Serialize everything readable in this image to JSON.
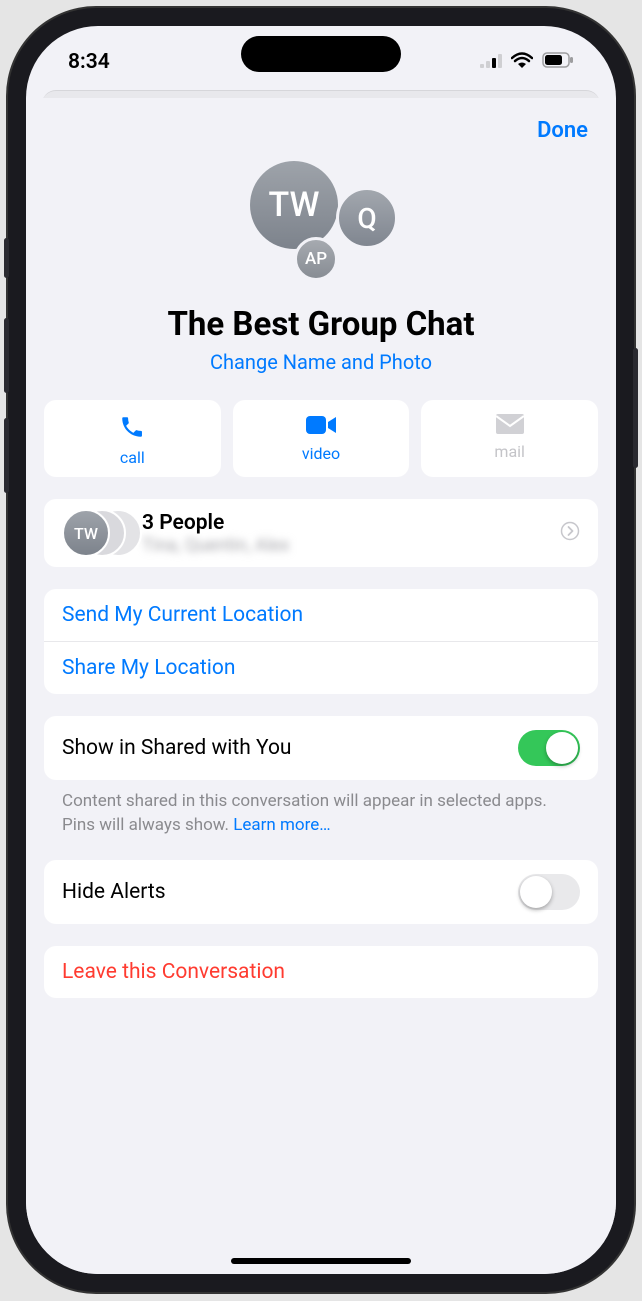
{
  "status": {
    "time": "8:34"
  },
  "header": {
    "done": "Done"
  },
  "group": {
    "avatars": [
      "TW",
      "Q",
      "AP"
    ],
    "title": "The Best Group Chat",
    "change": "Change Name and Photo"
  },
  "actions": {
    "call": "call",
    "video": "video",
    "mail": "mail"
  },
  "people": {
    "stack_av1": "TW",
    "title": "3 People",
    "names": "Tina, Quentin, Alex"
  },
  "location": {
    "send": "Send My Current Location",
    "share": "Share My Location"
  },
  "shared": {
    "label": "Show in Shared with You",
    "note_text": "Content shared in this conversation will appear in selected apps. Pins will always show. ",
    "learn": "Learn more…"
  },
  "alerts": {
    "label": "Hide Alerts"
  },
  "leave": {
    "label": "Leave this Conversation"
  }
}
